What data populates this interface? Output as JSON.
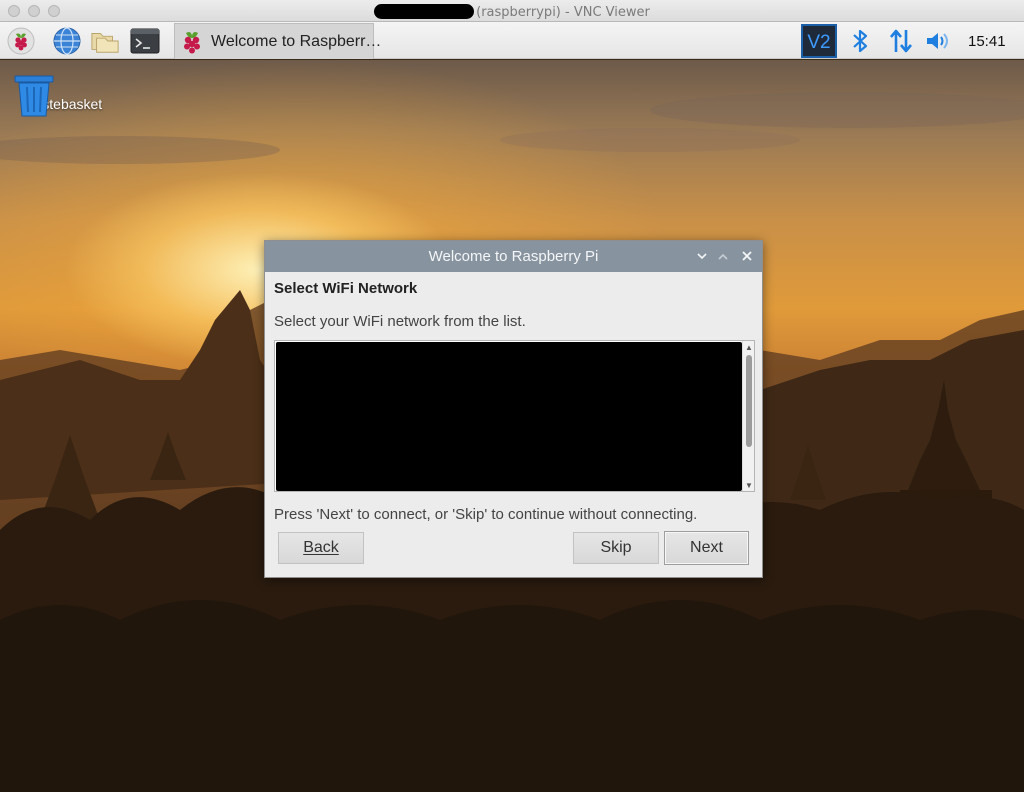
{
  "window": {
    "title": "(raspberrypi) - VNC Viewer"
  },
  "panel": {
    "launchers": [
      "raspberry-menu-icon",
      "web-browser-icon",
      "file-manager-icon",
      "terminal-icon"
    ],
    "task_button": {
      "label": "Welcome to Raspberr…"
    },
    "tray": [
      "vnc-server-icon",
      "bluetooth-icon",
      "network-icon",
      "volume-icon"
    ],
    "clock": "15:41"
  },
  "desktop": {
    "icons": [
      {
        "label": "Wastebasket",
        "icon": "wastebasket-icon"
      }
    ]
  },
  "dialog": {
    "title": "Welcome to Raspberry Pi",
    "heading": "Select WiFi Network",
    "prompt": "Select your WiFi network from the list.",
    "hint": "Press 'Next' to connect, or 'Skip' to continue without connecting.",
    "buttons": {
      "back": "Back",
      "skip": "Skip",
      "next": "Next"
    }
  },
  "colors": {
    "dialog_titlebar": "#87939e",
    "vnc_accent": "#1b5fa8",
    "tray_blue": "#1e7fe0"
  }
}
